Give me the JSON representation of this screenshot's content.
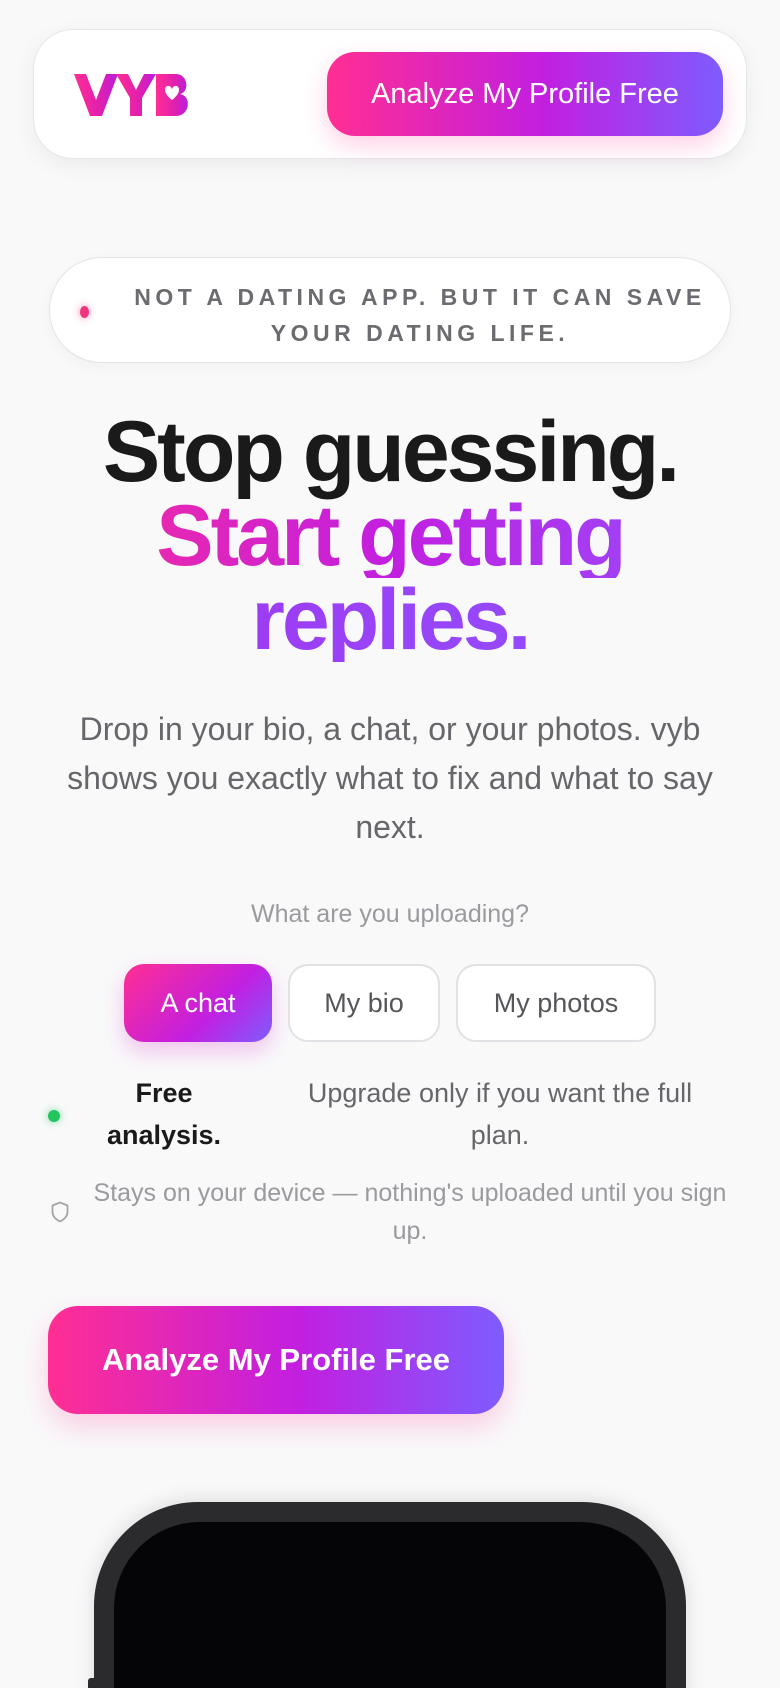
{
  "header": {
    "logo_text": "VYB",
    "cta_label": "Analyze My Profile Free"
  },
  "notice": {
    "text": "NOT A DATING APP. BUT IT CAN SAVE YOUR DATING LIFE."
  },
  "hero": {
    "line1": "Stop guessing.",
    "line2": "Start getting",
    "line3": "replies.",
    "subtitle": "Drop in your bio, a chat, or your photos. vyb shows you exactly what to fix and what to say next."
  },
  "upload": {
    "question": "What are you uploading?",
    "options": [
      "A chat",
      "My bio",
      "My photos"
    ],
    "selected": "A chat"
  },
  "free": {
    "bold": "Free analysis.",
    "rest": "Upgrade only if you want the full plan."
  },
  "privacy": {
    "text": "Stays on your device — nothing's uploaded until you sign up."
  },
  "cta": {
    "label": "Analyze My Profile Free"
  },
  "colors": {
    "pink": "#ff2e93",
    "purple": "#c21fe0",
    "violet": "#7e5cff",
    "green": "#22c55e"
  }
}
